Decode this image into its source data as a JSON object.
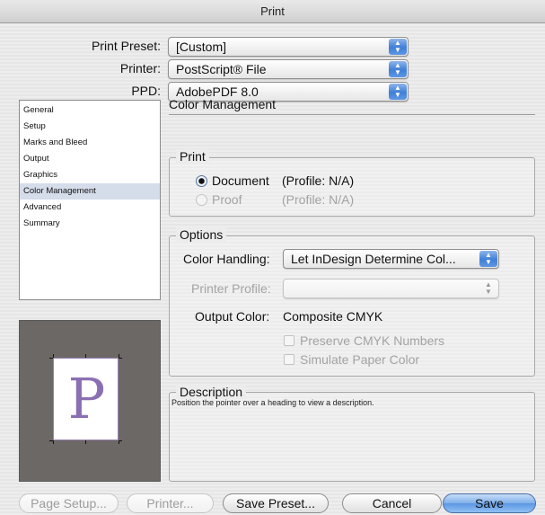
{
  "window": {
    "title": "Print"
  },
  "header": {
    "print_preset": {
      "label": "Print Preset:",
      "value": "[Custom]"
    },
    "printer": {
      "label": "Printer:",
      "value": "PostScript® File"
    },
    "ppd": {
      "label": "PPD:",
      "value": "AdobePDF 8.0"
    }
  },
  "sidebar": {
    "items": [
      {
        "label": "General"
      },
      {
        "label": "Setup"
      },
      {
        "label": "Marks and Bleed"
      },
      {
        "label": "Output"
      },
      {
        "label": "Graphics"
      },
      {
        "label": "Color Management",
        "selected": true
      },
      {
        "label": "Advanced"
      },
      {
        "label": "Summary"
      }
    ]
  },
  "preview": {
    "glyph": "P"
  },
  "main": {
    "title": "Color Management",
    "print_group": {
      "title": "Print",
      "document": {
        "label": "Document",
        "profile": "(Profile: N/A)",
        "selected": true
      },
      "proof": {
        "label": "Proof",
        "profile": "(Profile: N/A)",
        "selected": false,
        "enabled": false
      }
    },
    "options_group": {
      "title": "Options",
      "color_handling": {
        "label": "Color Handling:",
        "value": "Let InDesign Determine Col..."
      },
      "printer_profile": {
        "label": "Printer Profile:",
        "value": "",
        "enabled": false
      },
      "output_color": {
        "label": "Output Color:",
        "value": "Composite CMYK"
      },
      "preserve_cmyk": {
        "label": "Preserve CMYK Numbers",
        "checked": false,
        "enabled": false
      },
      "simulate_paper": {
        "label": "Simulate Paper Color",
        "checked": false,
        "enabled": false
      }
    },
    "description_group": {
      "title": "Description",
      "text": "Position the pointer over a heading to view a description."
    }
  },
  "footer": {
    "page_setup": "Page Setup...",
    "printer": "Printer...",
    "save_preset": "Save Preset...",
    "cancel": "Cancel",
    "save": "Save"
  },
  "colors": {
    "accent": "#5c97e3",
    "selection": "#d5dcea",
    "preview_bg": "#6b6866",
    "glyph": "#8a70b2"
  },
  "icons": {
    "popup_stepper": "up-down-arrows-icon",
    "radio_selected": "radio-on-icon"
  }
}
